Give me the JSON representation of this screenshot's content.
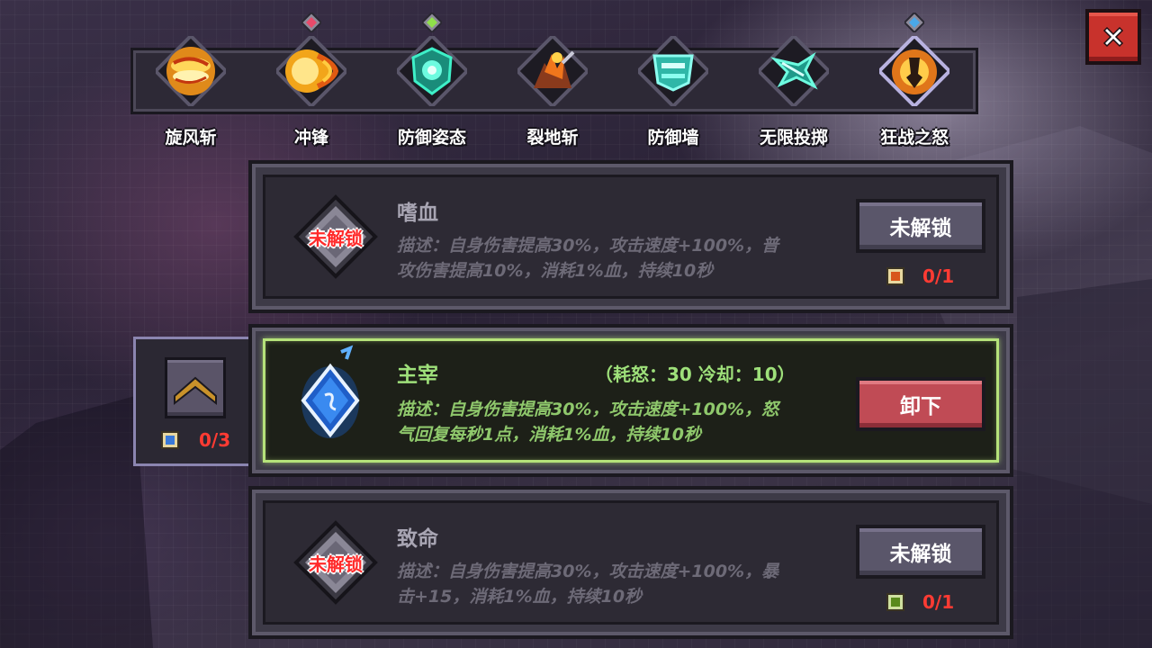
{
  "skills": [
    {
      "label": "旋风斩",
      "icon": "whirlwind-slash-icon",
      "gem": null
    },
    {
      "label": "冲锋",
      "icon": "charge-icon",
      "gem": "#e84a6a"
    },
    {
      "label": "防御姿态",
      "icon": "defensive-stance-icon",
      "gem": "#8fe04a"
    },
    {
      "label": "裂地斩",
      "icon": "ground-split-icon",
      "gem": null
    },
    {
      "label": "防御墙",
      "icon": "defense-wall-icon",
      "gem": null
    },
    {
      "label": "无限投掷",
      "icon": "infinite-throw-icon",
      "gem": null
    },
    {
      "label": "狂战之怒",
      "icon": "berserker-rage-icon",
      "gem": "#4aa8e8"
    }
  ],
  "side_panel": {
    "count": "0/3",
    "icon": "chevron-up-icon"
  },
  "cards": [
    {
      "title": "嗜血",
      "lock_label": "未解锁",
      "desc_line1": "描述：自身伤害提高30%，攻击速度+100%，普",
      "desc_line2": "攻伤害提高10%，消耗1%血，持续10秒",
      "button": "未解锁",
      "count": "0/1"
    },
    {
      "title": "主宰",
      "cost": "（耗怒：30  冷却：10）",
      "desc_line1": "描述：自身伤害提高30%，攻击速度+100%，怒",
      "desc_line2": "气回复每秒1点，消耗1%血，持续10秒",
      "button": "卸下"
    },
    {
      "title": "致命",
      "lock_label": "未解锁",
      "desc_line1": "描述：自身伤害提高30%，攻击速度+100%，暴",
      "desc_line2": "击+15，消耗1%血，持续10秒",
      "button": "未解锁",
      "count": "0/1"
    }
  ],
  "colors": {
    "accent_green": "#9ee07a",
    "count_red": "#ff3b33",
    "close_red": "#c8322c",
    "unequip_red": "#c04b55"
  }
}
